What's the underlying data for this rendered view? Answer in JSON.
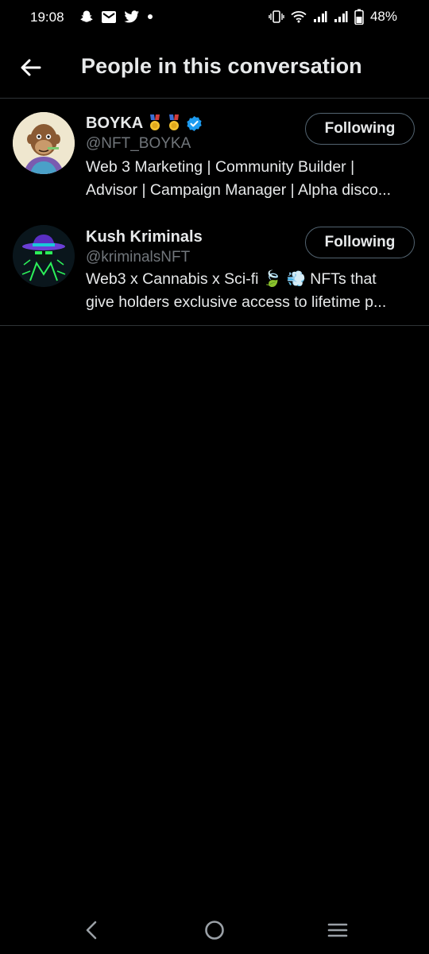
{
  "status_bar": {
    "time": "19:08",
    "left_icons": [
      "snapchat-icon",
      "gmail-icon",
      "twitter-icon",
      "dot-icon"
    ],
    "right_icons": [
      "vibrate-icon",
      "wifi-icon",
      "signal-icon",
      "signal-icon",
      "battery-icon"
    ],
    "battery": "48%"
  },
  "header": {
    "title": "People in this conversation",
    "back_icon": "arrow-left-icon"
  },
  "people": [
    {
      "name": "BOYKA",
      "badges": [
        "military-medal-icon",
        "military-medal-icon",
        "verified-badge-icon"
      ],
      "handle": "@NFT_BOYKA",
      "bio_lines": [
        "Web 3 Marketing | Community Builder |",
        "Advisor | Campaign Manager | Alpha disco..."
      ],
      "follow_label": "Following",
      "verified_color": "#1d9bf0"
    },
    {
      "name": "Kush Kriminals",
      "handle": "@kriminalsNFT",
      "bio_lines": [
        "Web3 x Cannabis x Sci-fi 🍃 💨 NFTs that",
        "give holders exclusive access to lifetime p..."
      ],
      "follow_label": "Following"
    }
  ],
  "nav_bar": {
    "icons": [
      "back-nav-icon",
      "home-nav-icon",
      "recents-nav-icon"
    ]
  },
  "colors": {
    "background": "#000000",
    "text": "#e7e9ea",
    "secondary_text": "#71767b",
    "divider": "#2f3336",
    "accent": "#1d9bf0"
  }
}
